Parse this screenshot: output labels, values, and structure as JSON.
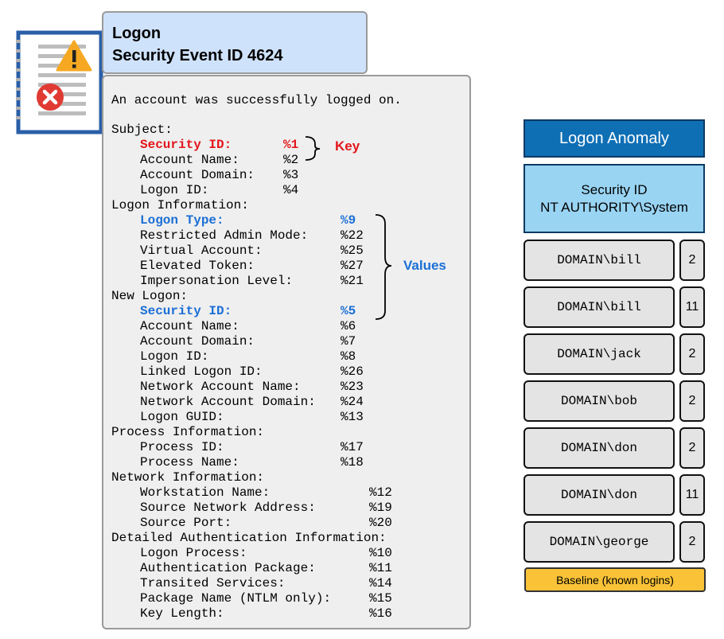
{
  "title": {
    "line1": "Logon",
    "line2": "Security Event ID 4624"
  },
  "event": {
    "message": "An account was successfully logged on.",
    "lines": [
      {
        "label": "Subject:"
      },
      {
        "label": "Security ID:",
        "value": "%1",
        "style": "red"
      },
      {
        "label": "Account Name:",
        "value": "%2"
      },
      {
        "label": "Account Domain:",
        "value": "%3"
      },
      {
        "label": "Logon ID:",
        "value": "%4"
      },
      {
        "label": "Logon Information:"
      },
      {
        "label": "Logon Type:",
        "value": "%9",
        "style": "blue"
      },
      {
        "label": "Restricted Admin Mode:",
        "value": "%22"
      },
      {
        "label": "Virtual Account:",
        "value": "%25"
      },
      {
        "label": "Elevated Token:",
        "value": "%27"
      },
      {
        "label": "Impersonation Level:",
        "value": "%21"
      },
      {
        "label": "New Logon:"
      },
      {
        "label": "Security ID:",
        "value": "%5",
        "style": "blue"
      },
      {
        "label": "Account Name:",
        "value": "%6"
      },
      {
        "label": "Account Domain:",
        "value": "%7"
      },
      {
        "label": "Logon ID:",
        "value": "%8"
      },
      {
        "label": "Linked Logon ID:",
        "value": "%26"
      },
      {
        "label": "Network Account Name:",
        "value": "%23"
      },
      {
        "label": "Network Account Domain:",
        "value": "%24"
      },
      {
        "label": "Logon GUID:",
        "value": "%13"
      },
      {
        "label": "Process Information:"
      },
      {
        "label": "Process ID:",
        "value": "%17"
      },
      {
        "label": "Process Name:",
        "value": "%18"
      },
      {
        "label": "Network Information:"
      },
      {
        "label": "Workstation Name:",
        "value": "%12"
      },
      {
        "label": "Source Network Address:",
        "value": "%19"
      },
      {
        "label": "Source Port:",
        "value": "%20"
      },
      {
        "label": "Detailed Authentication Information:"
      },
      {
        "label": "Logon Process:",
        "value": "%10"
      },
      {
        "label": "Authentication Package:",
        "value": "%11"
      },
      {
        "label": "Transited Services:",
        "value": "%14"
      },
      {
        "label": "Package Name (NTLM only):",
        "value": "%15"
      },
      {
        "label": "Key Length:",
        "value": "%16"
      }
    ]
  },
  "annotations": {
    "key": "Key",
    "values": "Values"
  },
  "anomaly": {
    "header": "Logon Anomaly",
    "security_id_label": "Security ID",
    "security_id_value": "NT AUTHORITY\\System",
    "logins": [
      {
        "name": "DOMAIN\\bill",
        "count": "2"
      },
      {
        "name": "DOMAIN\\bill",
        "count": "11"
      },
      {
        "name": "DOMAIN\\jack",
        "count": "2"
      },
      {
        "name": "DOMAIN\\bob",
        "count": "2"
      },
      {
        "name": "DOMAIN\\don",
        "count": "2"
      },
      {
        "name": "DOMAIN\\don",
        "count": "11"
      },
      {
        "name": "DOMAIN\\george",
        "count": "2"
      }
    ],
    "baseline_label": "Baseline (known logins)"
  },
  "colors": {
    "key_red": "#e3161b",
    "value_blue": "#1b6fd6",
    "header_blue": "#0e6fb5",
    "id_box_blue": "#99d4f3",
    "baseline_yellow": "#f9c237",
    "title_blue": "#cfe2fb"
  },
  "icons": [
    "document-warning-icon"
  ]
}
